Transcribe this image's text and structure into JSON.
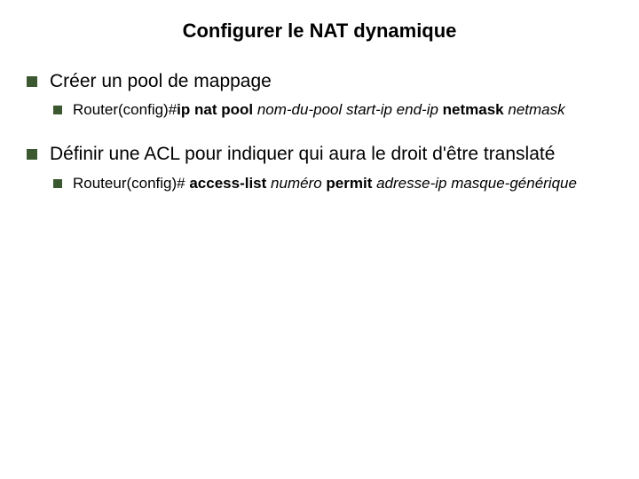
{
  "title": "Configurer le NAT dynamique",
  "items": [
    {
      "text": "Créer un pool de mappage",
      "sub": {
        "prefix": "Router(config)#",
        "cmd1": "ip nat pool ",
        "arg1": "nom-du-pool start-ip end-ip ",
        "cmd2": "netmask ",
        "arg2": "netmask"
      }
    },
    {
      "text": "Définir une ACL pour indiquer qui aura le droit d'être translaté",
      "sub": {
        "prefix": "Routeur(config)# ",
        "cmd1": "access-list ",
        "arg1": "numéro ",
        "cmd2": "permit ",
        "arg2": "adresse-ip masque-générique"
      }
    }
  ]
}
